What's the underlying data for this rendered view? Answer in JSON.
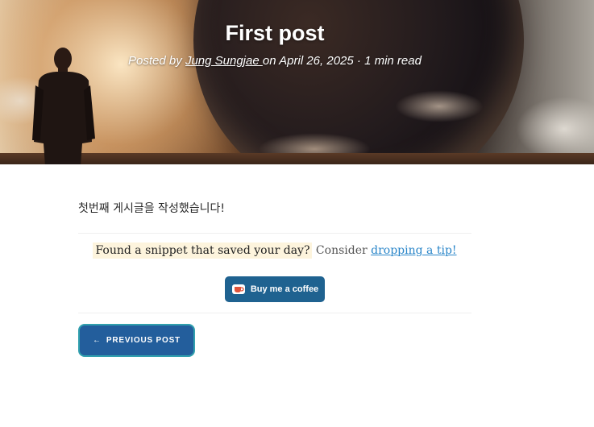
{
  "post": {
    "title": "First post",
    "meta": {
      "prefix": "Posted by ",
      "author": "Jung Sungjae ",
      "date_text": "on April 26, 2025",
      "separator": " · ",
      "read_time": "1 min read"
    },
    "body": "첫번째 게시글을 작성했습니다!"
  },
  "support": {
    "highlight": "Found a snippet that saved your day?",
    "consider": "Consider",
    "tip_link": "dropping a tip!",
    "coffee_button": "Buy me a coffee",
    "coffee_icon": "coffee-cup-icon"
  },
  "pager": {
    "arrow": "←",
    "previous": "PREVIOUS POST"
  },
  "colors": {
    "coffee_button": "#1f6290",
    "previous_button": "#235e9c",
    "link": "#2a86c9",
    "highlight": "#fdf4dd"
  }
}
